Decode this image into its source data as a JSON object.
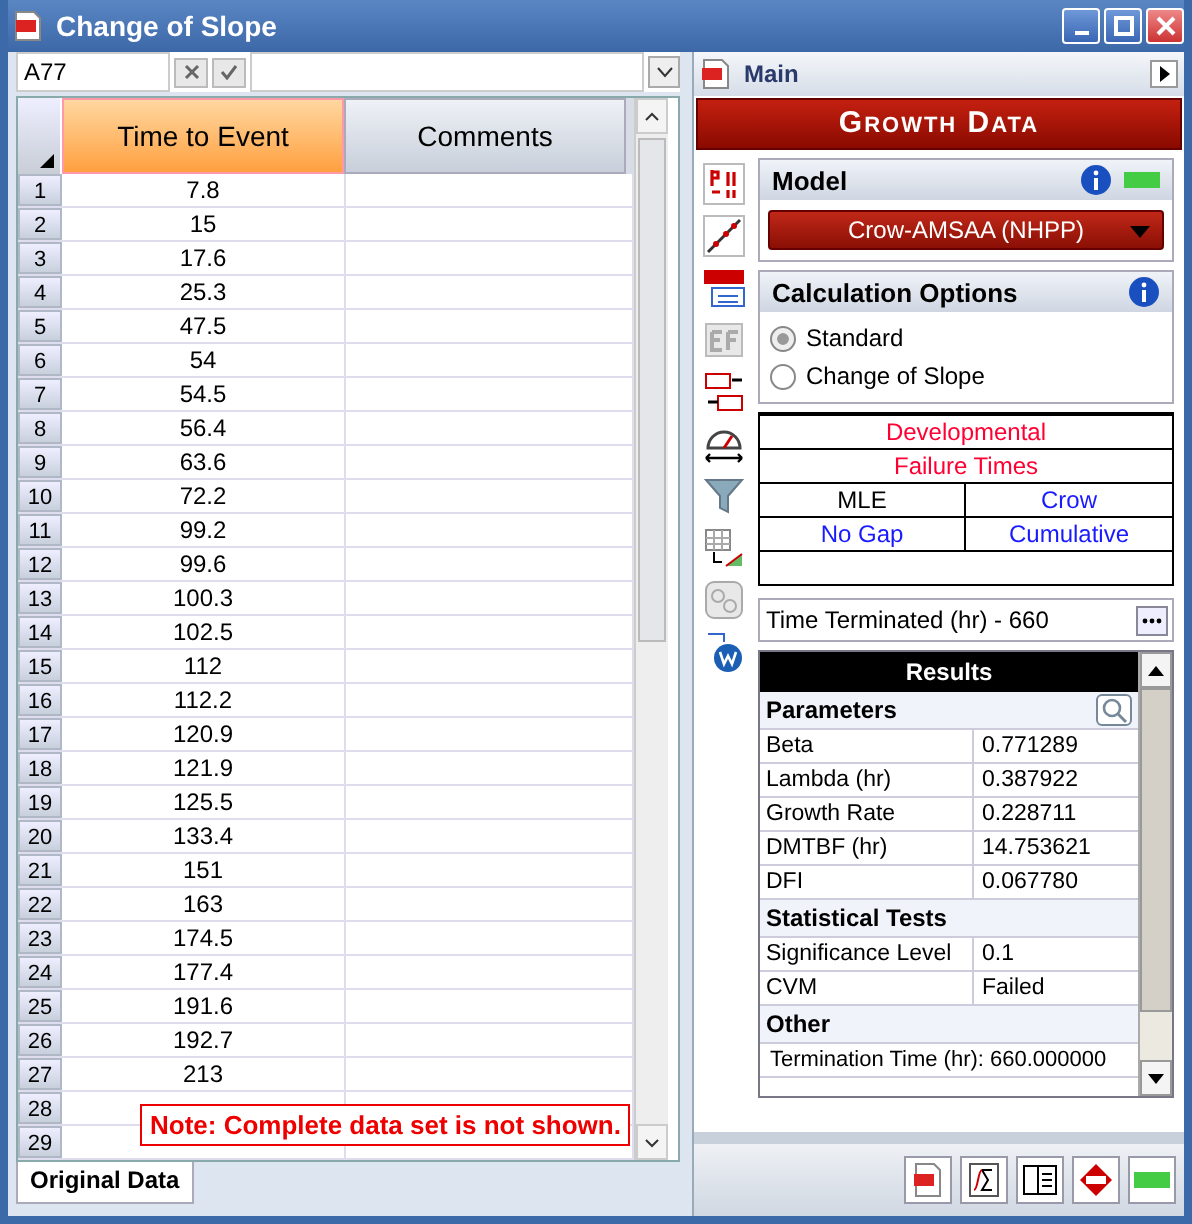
{
  "window": {
    "title": "Change of Slope"
  },
  "formula_bar": {
    "cell": "A77"
  },
  "grid": {
    "columns": [
      {
        "label": "Time to Event",
        "selected": true
      },
      {
        "label": "Comments",
        "selected": false
      }
    ],
    "rows": [
      {
        "number": "1",
        "time": "7.8"
      },
      {
        "number": "2",
        "time": "15"
      },
      {
        "number": "3",
        "time": "17.6"
      },
      {
        "number": "4",
        "time": "25.3"
      },
      {
        "number": "5",
        "time": "47.5"
      },
      {
        "number": "6",
        "time": "54"
      },
      {
        "number": "7",
        "time": "54.5"
      },
      {
        "number": "8",
        "time": "56.4"
      },
      {
        "number": "9",
        "time": "63.6"
      },
      {
        "number": "10",
        "time": "72.2"
      },
      {
        "number": "11",
        "time": "99.2"
      },
      {
        "number": "12",
        "time": "99.6"
      },
      {
        "number": "13",
        "time": "100.3"
      },
      {
        "number": "14",
        "time": "102.5"
      },
      {
        "number": "15",
        "time": "112"
      },
      {
        "number": "16",
        "time": "112.2"
      },
      {
        "number": "17",
        "time": "120.9"
      },
      {
        "number": "18",
        "time": "121.9"
      },
      {
        "number": "19",
        "time": "125.5"
      },
      {
        "number": "20",
        "time": "133.4"
      },
      {
        "number": "21",
        "time": "151"
      },
      {
        "number": "22",
        "time": "163"
      },
      {
        "number": "23",
        "time": "174.5"
      },
      {
        "number": "24",
        "time": "177.4"
      },
      {
        "number": "25",
        "time": "191.6"
      },
      {
        "number": "26",
        "time": "192.7"
      },
      {
        "number": "27",
        "time": "213"
      },
      {
        "number": "28"
      },
      {
        "number": "29"
      }
    ]
  },
  "note": "Note: Complete data set is not shown.",
  "sheet_tabs": [
    {
      "label": "Original Data",
      "selected": true
    }
  ],
  "panel": {
    "header": "Main",
    "banner": "Growth Data",
    "model": {
      "title": "Model",
      "value": "Crow-AMSAA (NHPP)"
    },
    "calc_options": {
      "title": "Calculation Options",
      "options": [
        {
          "label": "Standard",
          "selected": true
        },
        {
          "label": "Change of Slope",
          "selected": false
        }
      ]
    },
    "summary": {
      "lines": [
        {
          "text": "Developmental",
          "color": "#ff0033"
        },
        {
          "text": "Failure Times",
          "color": "#ff0033"
        }
      ],
      "cells": [
        {
          "text": "MLE",
          "color": "#000000"
        },
        {
          "text": "Crow",
          "color": "#1a1aff"
        },
        {
          "text": "No Gap",
          "color": "#1a1aff"
        },
        {
          "text": "Cumulative",
          "color": "#1a1aff"
        }
      ]
    },
    "termination": "Time Terminated (hr) - 660",
    "results": {
      "title": "Results",
      "sections": [
        {
          "title": "Parameters",
          "rows": [
            {
              "kind": "pair",
              "label": "Beta",
              "value": "0.771289"
            },
            {
              "kind": "pair",
              "label": "Lambda (hr)",
              "value": "0.387922"
            },
            {
              "kind": "pair",
              "label": "Growth Rate",
              "value": "0.228711"
            },
            {
              "kind": "pair",
              "label": "DMTBF (hr)",
              "value": "14.753621"
            },
            {
              "kind": "pair",
              "label": "DFI",
              "value": "0.067780"
            }
          ]
        },
        {
          "title": "Statistical Tests",
          "rows": [
            {
              "kind": "pair",
              "label": "Significance Level",
              "value": "0.1"
            },
            {
              "kind": "pair",
              "label": "CVM",
              "value": "Failed"
            }
          ]
        },
        {
          "title": "Other",
          "rows": [
            {
              "kind": "line",
              "label": "Termination Time (hr): 660.000000"
            }
          ]
        }
      ]
    }
  }
}
